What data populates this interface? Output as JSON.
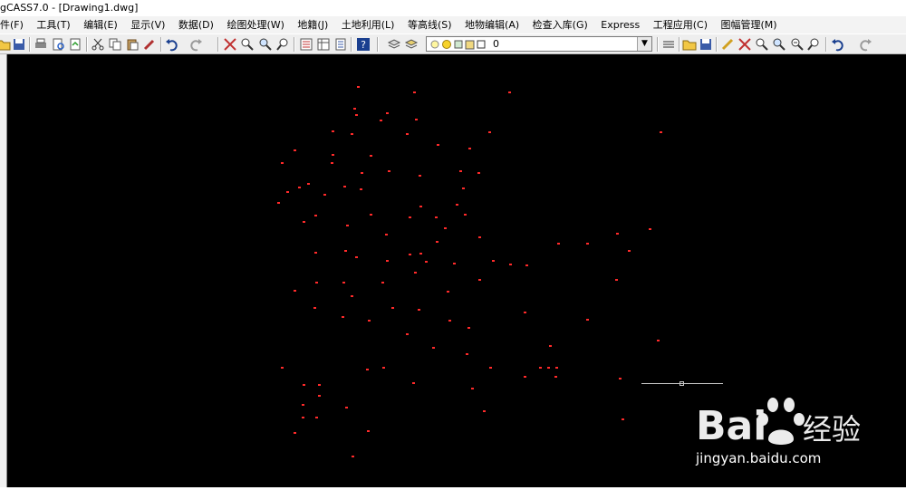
{
  "window": {
    "title": "gCASS7.0 - [Drawing1.dwg]"
  },
  "menu": [
    {
      "label": "件(F)"
    },
    {
      "label": "工具(T)"
    },
    {
      "label": "编辑(E)"
    },
    {
      "label": "显示(V)"
    },
    {
      "label": "数据(D)"
    },
    {
      "label": "绘图处理(W)"
    },
    {
      "label": "地籍(J)"
    },
    {
      "label": "土地利用(L)"
    },
    {
      "label": "等高线(S)"
    },
    {
      "label": "地物编辑(A)"
    },
    {
      "label": "检查入库(G)"
    },
    {
      "label": "Express"
    },
    {
      "label": "工程应用(C)"
    },
    {
      "label": "图幅管理(M)"
    }
  ],
  "toolbar": {
    "layer_combo": {
      "value": "0"
    },
    "icons": [
      "open-icon",
      "save-icon",
      "print-icon",
      "print-preview-icon",
      "publish-icon",
      "cut-icon",
      "copy-icon",
      "paste-icon",
      "match-prop-icon",
      "undo-icon",
      "redo-icon",
      "pan-icon",
      "zoom-realtime-icon",
      "zoom-window-icon",
      "zoom-previous-icon",
      "properties-icon",
      "design-center-icon",
      "tool-palette-icon",
      "help-icon",
      "layer-manager-icon",
      "layer-previous-icon",
      "bulb-icon",
      "sun-icon",
      "lock-icon",
      "color-swatch-icon",
      "lineweight-icon",
      "open2-icon",
      "save2-icon",
      "pencil-icon",
      "pan2-icon",
      "zoom2-icon",
      "zoom-in-icon",
      "zoom-out-icon",
      "zoom-prev2-icon",
      "undo2-icon",
      "redo2-icon"
    ]
  },
  "watermark": {
    "brand": "Bai du 经验",
    "url": "jingyan.baidu.com"
  },
  "colors": {
    "canvas": "#000000",
    "points": "#ff2a2a",
    "crosshair": "#c8c8c8"
  }
}
